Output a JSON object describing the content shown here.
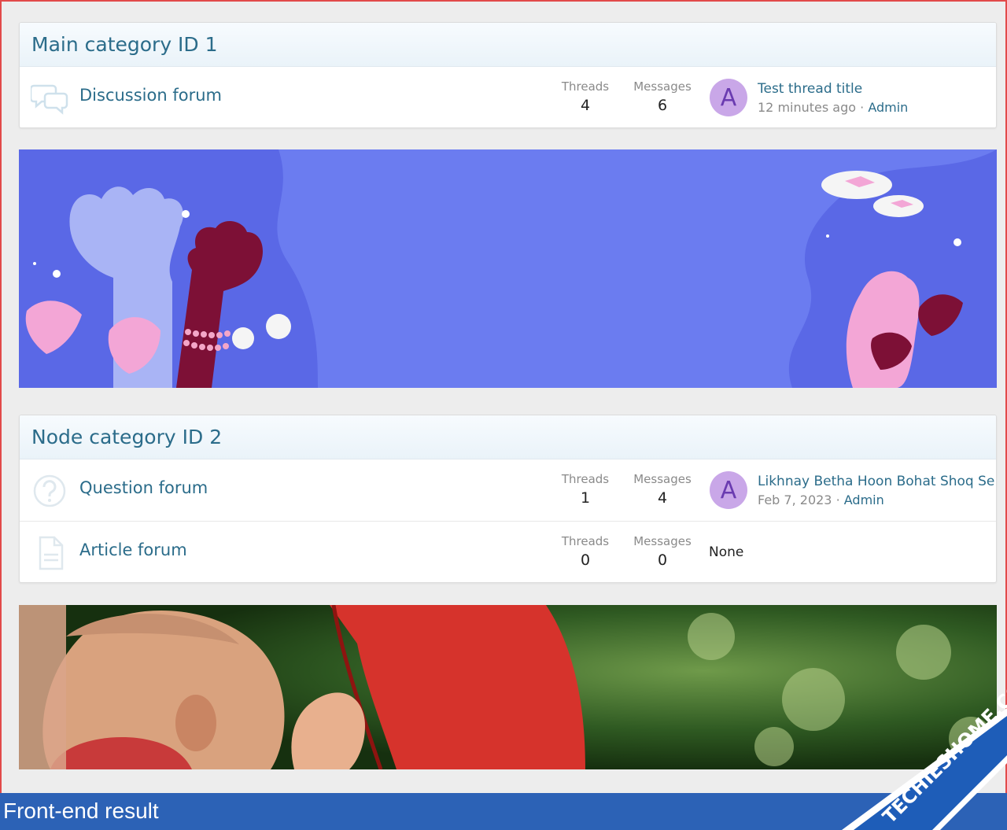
{
  "category1": {
    "title": "Main category ID 1",
    "nodes": [
      {
        "title": "Discussion forum",
        "icon": "chat-bubbles-icon",
        "threads_label": "Threads",
        "threads": "4",
        "messages_label": "Messages",
        "messages": "6",
        "avatar_letter": "A",
        "last_thread": "Test thread title",
        "last_time": "12 minutes ago",
        "last_sep": "·",
        "last_user": "Admin"
      }
    ]
  },
  "category2": {
    "title": "Node category ID 2",
    "nodes": [
      {
        "title": "Question forum",
        "icon": "question-circle-icon",
        "threads_label": "Threads",
        "threads": "1",
        "messages_label": "Messages",
        "messages": "4",
        "avatar_letter": "A",
        "last_thread": "Likhnay Betha Hoon Bohat Shoq Se...",
        "last_time": "Feb 7, 2023",
        "last_sep": "·",
        "last_user": "Admin"
      },
      {
        "title": "Article forum",
        "icon": "document-icon",
        "threads_label": "Threads",
        "threads": "0",
        "messages_label": "Messages",
        "messages": "0",
        "last_none": "None"
      }
    ]
  },
  "footer": {
    "caption": "Front-end result"
  },
  "watermark": {
    "text": "TECHIESHOME.COM"
  },
  "colors": {
    "link": "#2b6c8a",
    "avatar_bg": "#c9a7e8",
    "banner_blue": "#6b7cf0",
    "footer_blue": "#2c62b6",
    "watermark_blue": "#1e5db8",
    "watermark_orange": "#f39a1c"
  }
}
